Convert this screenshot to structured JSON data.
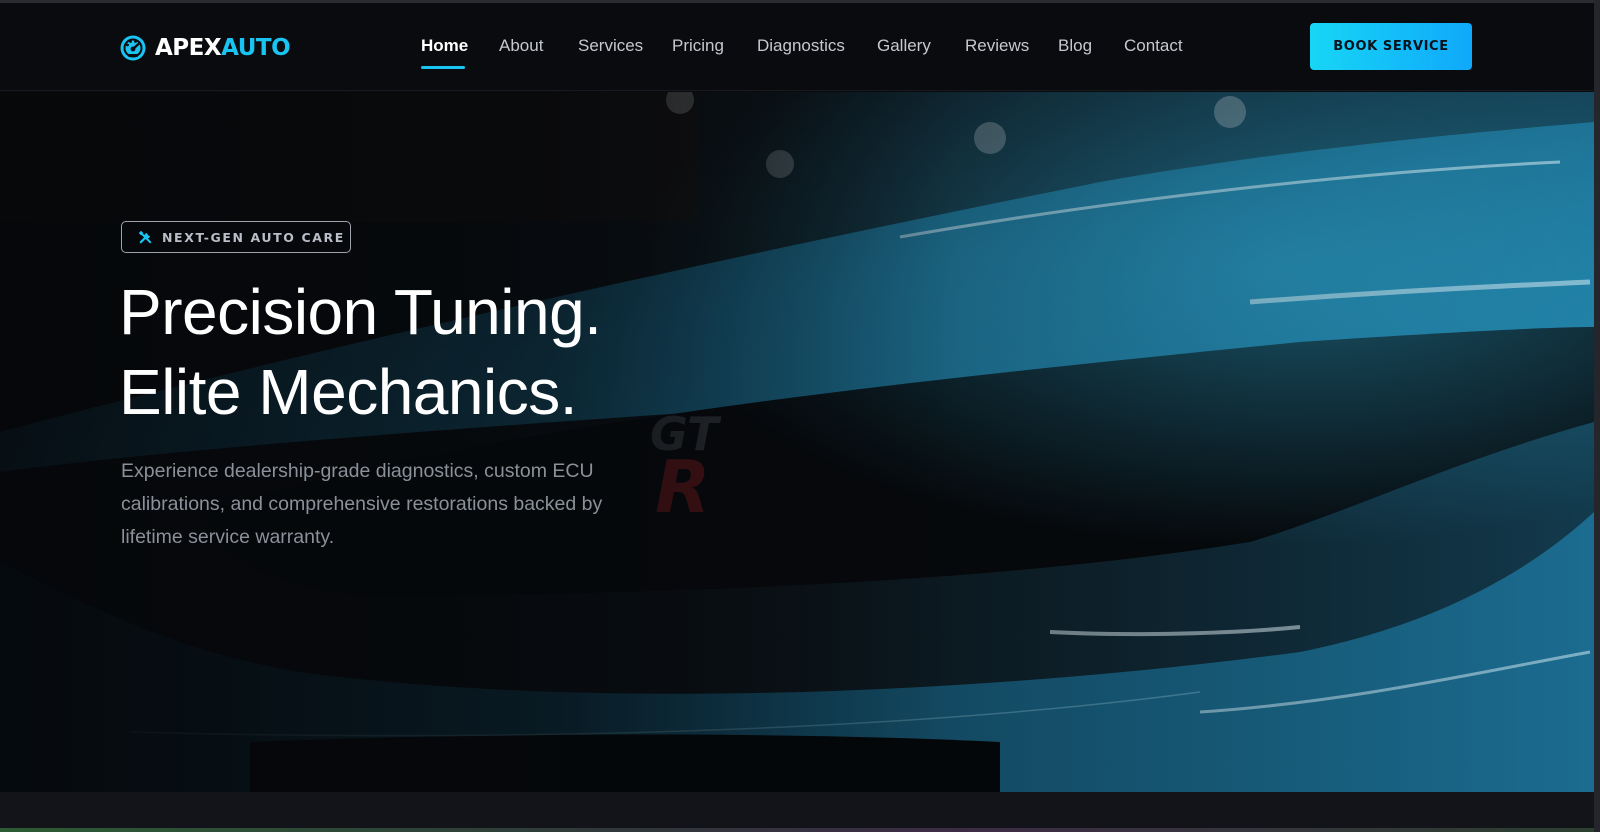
{
  "brand": {
    "name_part1": "APEX",
    "name_part2": "AUTO",
    "icon": "gauge-icon"
  },
  "nav": {
    "items": [
      {
        "label": "Home",
        "active": true
      },
      {
        "label": "About"
      },
      {
        "label": "Services"
      },
      {
        "label": "Pricing"
      },
      {
        "label": "Diagnostics"
      },
      {
        "label": "Gallery"
      },
      {
        "label": "Reviews"
      },
      {
        "label": "Blog"
      },
      {
        "label": "Contact"
      }
    ],
    "cta_label": "BOOK SERVICE"
  },
  "hero": {
    "badge_icon": "tools-icon",
    "badge_text": "NEXT-GEN AUTO CARE",
    "title_line1": "Precision Tuning.",
    "title_line2": "Elite Mechanics.",
    "description": "Experience dealership-grade diagnostics, custom ECU calibrations, and comprehensive restorations backed by lifetime service warranty."
  },
  "colors": {
    "accent": "#19c3f2",
    "cta_gradient_start": "#17d6f5",
    "cta_gradient_end": "#10a8fb",
    "nav_background": "#0a0b0e",
    "hero_car_paint": "#1d6f93"
  }
}
